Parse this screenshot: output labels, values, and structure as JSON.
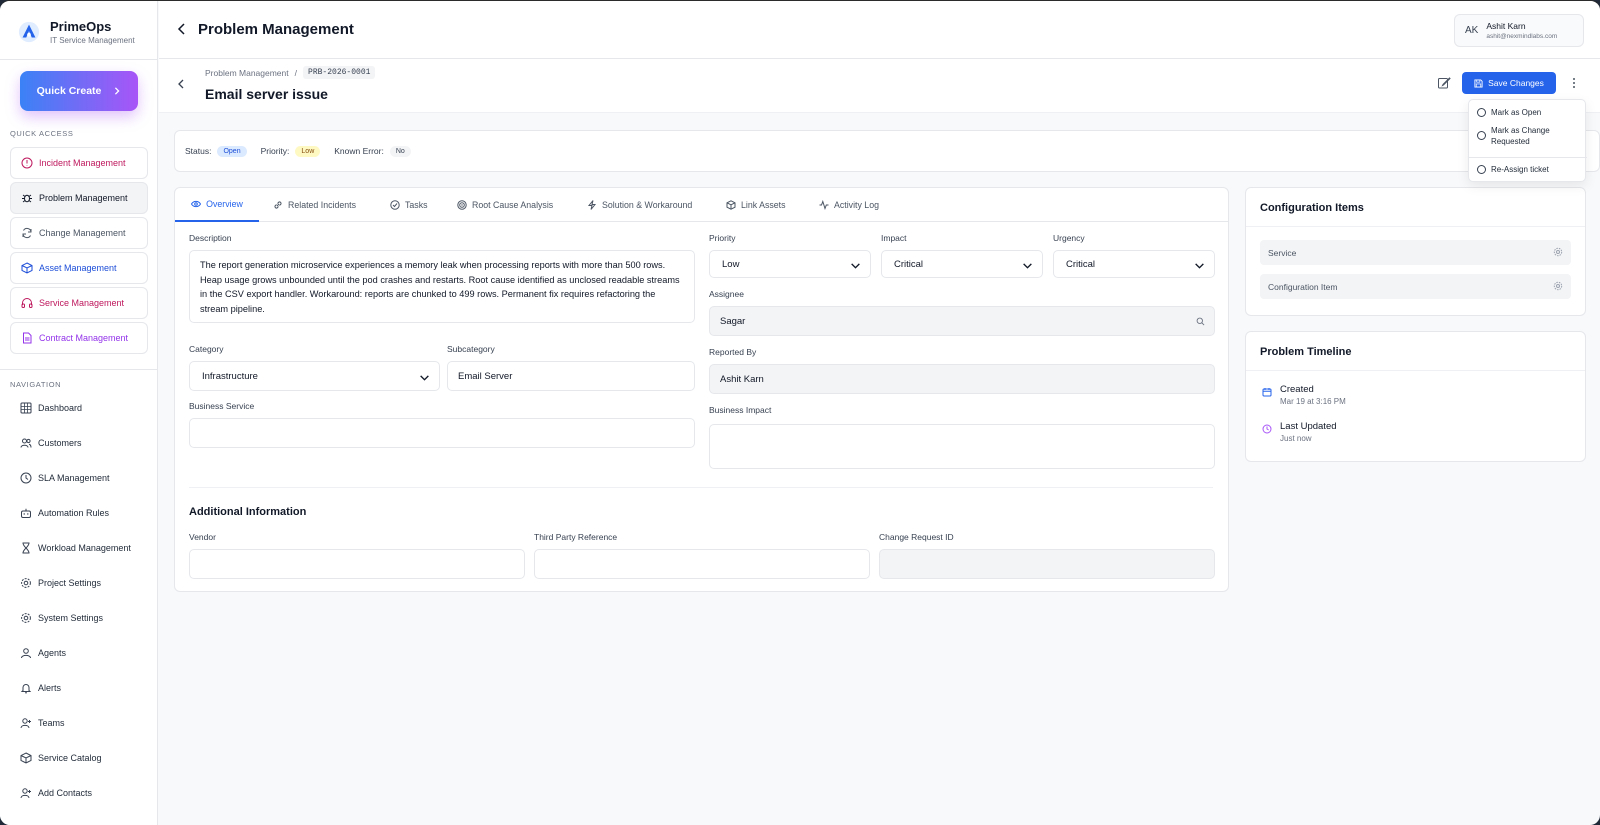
{
  "brand": {
    "name": "PrimeOps",
    "subtitle": "IT Service Management"
  },
  "quick_create": {
    "label": "Quick Create"
  },
  "quick_access": {
    "title": "QUICK ACCESS",
    "items": [
      {
        "label": "Incident Management",
        "color": "#be185d"
      },
      {
        "label": "Problem Management",
        "color": "#111827"
      },
      {
        "label": "Change Management",
        "color": "#4b5563"
      },
      {
        "label": "Asset Management",
        "color": "#1d4ed8"
      },
      {
        "label": "Service Management",
        "color": "#be185d"
      },
      {
        "label": "Contract Management",
        "color": "#9333ea"
      }
    ]
  },
  "navigation": {
    "title": "NAVIGATION",
    "items": [
      {
        "label": "Dashboard"
      },
      {
        "label": "Customers"
      },
      {
        "label": "SLA Management"
      },
      {
        "label": "Automation Rules"
      },
      {
        "label": "Workload Management"
      },
      {
        "label": "Project Settings"
      },
      {
        "label": "System Settings"
      },
      {
        "label": "Agents"
      },
      {
        "label": "Alerts"
      },
      {
        "label": "Teams"
      },
      {
        "label": "Service Catalog"
      },
      {
        "label": "Add Contacts"
      }
    ]
  },
  "header": {
    "title": "Problem Management",
    "user": {
      "initials": "AK",
      "name": "Ashit Karn",
      "email": "ashit@nexmindlabs.com"
    }
  },
  "record": {
    "breadcrumb_parent": "Problem Management",
    "breadcrumb_sep": "/",
    "id": "PRB-2026-0001",
    "title": "Email server issue",
    "save_label": "Save Changes"
  },
  "actions_menu": {
    "items": [
      {
        "label": "Mark as Open"
      },
      {
        "label": "Mark as Change Requested"
      },
      {
        "label": "Re-Assign ticket"
      }
    ]
  },
  "status_bar": {
    "status_label": "Status:",
    "status_value": "Open",
    "priority_label": "Priority:",
    "priority_value": "Low",
    "known_error_label": "Known Error:",
    "known_error_value": "No"
  },
  "tabs": [
    {
      "label": "Overview"
    },
    {
      "label": "Related Incidents"
    },
    {
      "label": "Tasks"
    },
    {
      "label": "Root Cause Analysis"
    },
    {
      "label": "Solution & Workaround"
    },
    {
      "label": "Link Assets"
    },
    {
      "label": "Activity Log"
    }
  ],
  "form": {
    "description_label": "Description",
    "description_value": "The report generation microservice experiences a memory leak when processing reports with more than 500 rows. Heap usage grows unbounded until the pod crashes and restarts. Root cause identified as unclosed readable streams in the CSV export handler. Workaround: reports are chunked to 499 rows. Permanent fix requires refactoring the stream pipeline.",
    "category_label": "Category",
    "category_value": "Infrastructure",
    "subcategory_label": "Subcategory",
    "subcategory_value": "Email Server",
    "business_service_label": "Business Service",
    "business_service_value": "",
    "priority_label": "Priority",
    "priority_value": "Low",
    "impact_label": "Impact",
    "impact_value": "Critical",
    "urgency_label": "Urgency",
    "urgency_value": "Critical",
    "assignee_label": "Assignee",
    "assignee_value": "Sagar",
    "reported_by_label": "Reported By",
    "reported_by_value": "Ashit Karn",
    "business_impact_label": "Business Impact",
    "business_impact_value": "",
    "additional_title": "Additional Information",
    "vendor_label": "Vendor",
    "vendor_value": "",
    "third_party_label": "Third Party Reference",
    "third_party_value": "",
    "change_request_label": "Change Request ID",
    "change_request_value": ""
  },
  "configuration_items": {
    "title": "Configuration Items",
    "rows": [
      {
        "label": "Service"
      },
      {
        "label": "Configuration Item"
      }
    ]
  },
  "timeline": {
    "title": "Problem Timeline",
    "events": [
      {
        "title": "Created",
        "sub": "Mar 19 at 3:16 PM",
        "color": "#2563eb"
      },
      {
        "title": "Last Updated",
        "sub": "Just now",
        "color": "#a855f7"
      }
    ]
  }
}
